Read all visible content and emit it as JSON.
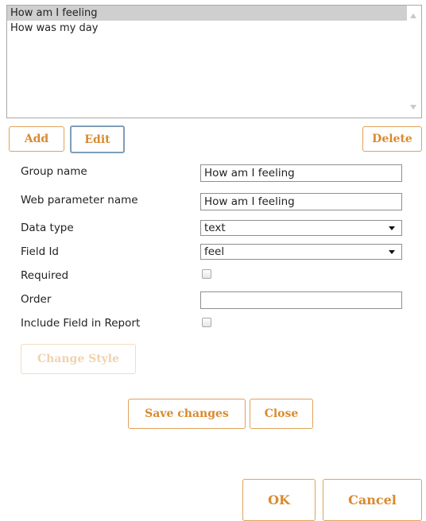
{
  "list": {
    "items": [
      "How am I feeling",
      "How was my day"
    ],
    "selected_index": 0
  },
  "buttons": {
    "add": "Add",
    "edit": "Edit",
    "delete": "Delete",
    "change_style": "Change Style",
    "save_changes": "Save changes",
    "close": "Close",
    "ok": "OK",
    "cancel": "Cancel"
  },
  "form": {
    "group_name_label": "Group name",
    "group_name_value": "How am I feeling",
    "web_param_label": "Web parameter name",
    "web_param_value": "How am I feeling",
    "data_type_label": "Data type",
    "data_type_value": "text",
    "field_id_label": "Field Id",
    "field_id_value": "feel",
    "required_label": "Required",
    "required_checked": false,
    "order_label": "Order",
    "order_value": "",
    "include_report_label": "Include Field in Report",
    "include_report_checked": false
  },
  "colors": {
    "accent": "#d98a2e",
    "accent_border": "#e0a25c",
    "selection": "#cfcfcf"
  }
}
